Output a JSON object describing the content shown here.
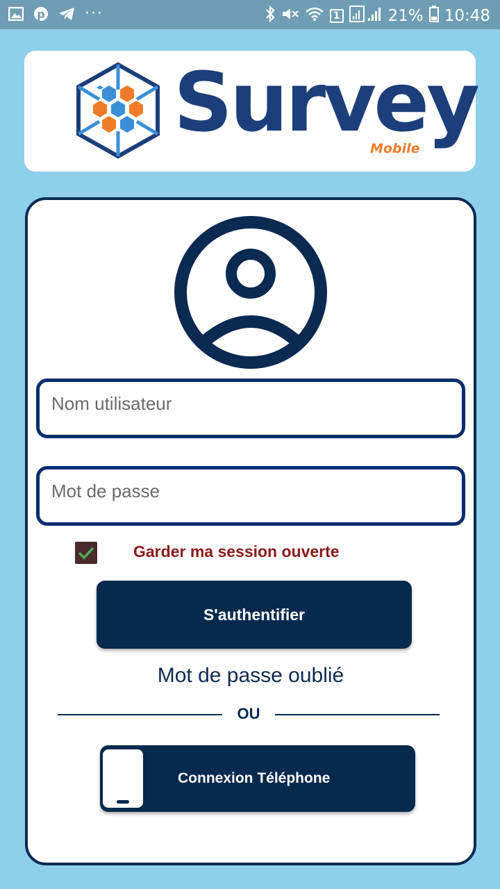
{
  "status_bar": {
    "left_icons": [
      "image-icon",
      "pinterest-icon",
      "telegram-icon"
    ],
    "more": "···",
    "right_icons": [
      "bluetooth-icon",
      "mute-icon",
      "wifi-icon",
      "sim-icon",
      "signal-icon"
    ],
    "sim_badge": "1",
    "battery": "21%",
    "time": "10:48"
  },
  "logo": {
    "title": "Survey",
    "subtitle": "Mobile",
    "colors": {
      "primary": "#1c3e7a",
      "accent": "#f07c2a",
      "hex_blue": "#3a8fd8"
    }
  },
  "login": {
    "username_placeholder": "Nom utilisateur",
    "password_placeholder": "Mot de passe",
    "remember_label": "Garder ma session ouverte",
    "remember_checked": true,
    "submit_label": "S'authentifier",
    "forgot_label": "Mot de passe oublié",
    "or_label": "OU",
    "phone_button_label": "Connexion Téléphone"
  },
  "colors": {
    "background": "#8ecfec",
    "dark_navy": "#062a4e",
    "remember_text": "#8b1a1a"
  }
}
